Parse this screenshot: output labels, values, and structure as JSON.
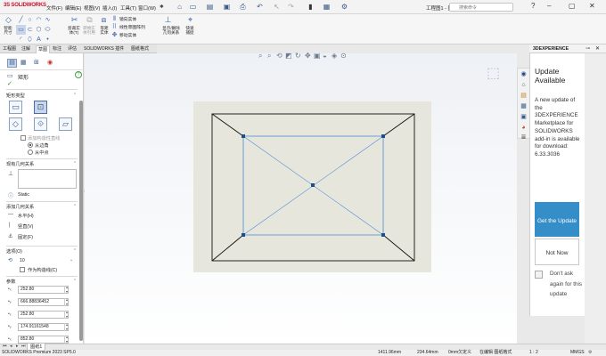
{
  "title_bar": {
    "brand_prefix": "3S",
    "brand": "SOLIDWORKS",
    "menus": [
      "文件(F)",
      "编辑(E)",
      "视图(V)",
      "插入(I)",
      "工具(T)",
      "窗口(W)"
    ],
    "doc_title": "工程图1 - 图纸1 *",
    "search_placeholder": "搜索命令"
  },
  "command_manager": {
    "tools": [
      {
        "label": "智能\n尺寸"
      },
      {
        "label": "剪裁实\n体(T)"
      },
      {
        "label": "转换实\n体引用"
      },
      {
        "label": "等距\n实体"
      },
      {
        "label": "显示/删除\n几何关系"
      },
      {
        "label": "快速\n捕捉"
      }
    ],
    "row_tools": [
      "镜向实体",
      "线性草图阵列",
      "移动实体"
    ]
  },
  "tabs": [
    "工程图",
    "注解",
    "草图",
    "标注",
    "评估",
    "SOLIDWORKS 插件",
    "图纸格式"
  ],
  "active_tab": "草图",
  "property_manager": {
    "title": "矩形",
    "rect_type_label": "矩形类型",
    "add_construction": "添加构造性直线",
    "from_corner": "从边角",
    "from_midpoint": "从中点",
    "existing_relations": "现有几何关系",
    "static_label": "Static",
    "add_relations": "添加几何关系",
    "relations": [
      "水平(H)",
      "竖直(V)",
      "固定(F)"
    ],
    "options_label": "选项(O)",
    "option_value": "10",
    "construction_label": "作为构造线(C)",
    "params_label": "参数",
    "params": [
      "252.80",
      "666.88836452",
      "252.80",
      "174.91161548",
      "852.80"
    ]
  },
  "xpanel": {
    "header": "3DEXPERIENCE",
    "title": "Update Available",
    "body": "A new update of the 3DEXPERIENCE Marketplace for SOLIDWORKS add-in is available for download: 6.33.3036",
    "get_button": "Get the Update",
    "not_now_button": "Not Now",
    "dont_ask": "Don't ask again for this update"
  },
  "bottom": {
    "model_tab": "图纸1",
    "status_left": "SOLIDWORKS Premium 2023 SP5.0",
    "coord_x": "1411.96mm",
    "coord_y": "234.64mm",
    "coord_z": "0mm",
    "status_right": "欠定义",
    "edit_state": "在编辑 图纸格式",
    "scale": "1 : 2",
    "units": "MMGS"
  },
  "colors": {
    "sketch_blue": "#4a8fd4",
    "sheet_bg": "#e7e6dc",
    "accent_button": "#368ec8"
  }
}
